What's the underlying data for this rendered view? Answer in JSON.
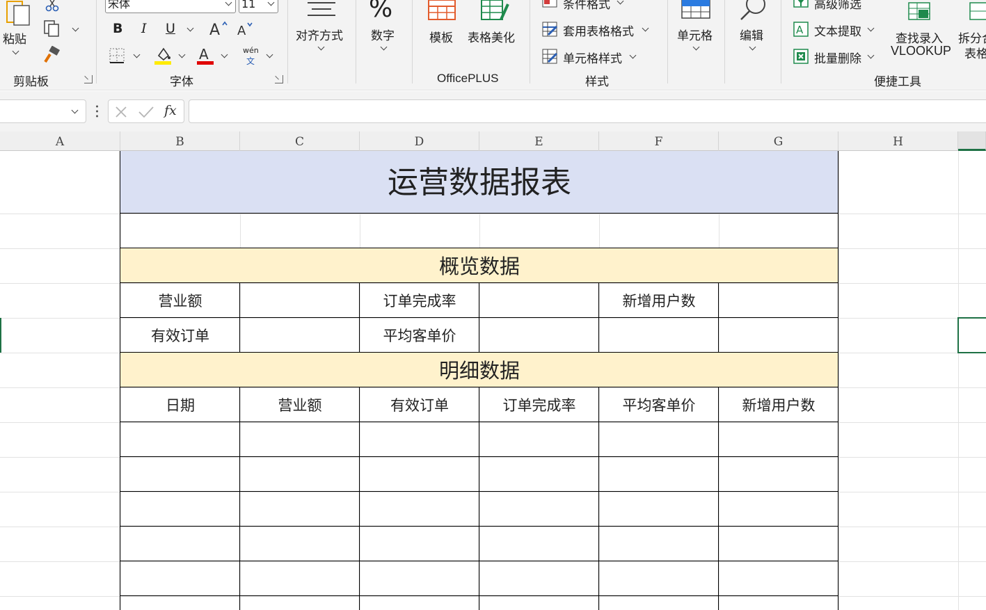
{
  "ribbon": {
    "clipboard": {
      "paste_label": "粘贴",
      "group_label": "剪贴板"
    },
    "font": {
      "font_name": "宋体",
      "font_size": "11",
      "group_label": "字体",
      "bold": "B",
      "italic": "I",
      "underline": "U",
      "phonetic_top": "wén",
      "phonetic_bottom": "文",
      "highlight_color": "#ffeb00",
      "font_color": "#e00000"
    },
    "alignment": {
      "label": "对齐方式"
    },
    "number": {
      "label": "数字",
      "symbol": "%"
    },
    "officeplus": {
      "template_label": "模板",
      "beautify_label": "表格美化",
      "group_label": "OfficePLUS"
    },
    "styles": {
      "conditional_label": "条件格式",
      "table_format_label": "套用表格格式",
      "cell_style_label": "单元格样式",
      "group_label": "样式"
    },
    "cells": {
      "label": "单元格"
    },
    "editing": {
      "label": "编辑"
    },
    "tools": {
      "advanced_filter_label": "高级筛选",
      "text_extract_label": "文本提取",
      "batch_delete_label": "批量删除",
      "lookup_line1": "查找录入",
      "lookup_line2": "VLOOKUP",
      "split_line1": "拆分合",
      "split_line2": "表格",
      "group_label": "便捷工具"
    }
  },
  "formula_bar": {
    "name_box_value": "",
    "formula_value": "",
    "fx_label": "fx"
  },
  "columns": [
    "A",
    "B",
    "C",
    "D",
    "E",
    "F",
    "G",
    "H"
  ],
  "sheet": {
    "title": "运营数据报表",
    "title_bg": "#dae0f3",
    "section_bg": "#fff2cc",
    "overview_title": "概览数据",
    "overview_row1": [
      "营业额",
      "",
      "订单完成率",
      "",
      "新增用户数",
      ""
    ],
    "overview_row2": [
      "有效订单",
      "",
      "平均客单价",
      "",
      "",
      ""
    ],
    "detail_title": "明细数据",
    "detail_headers": [
      "日期",
      "营业额",
      "有效订单",
      "订单完成率",
      "平均客单价",
      "新增用户数"
    ]
  }
}
